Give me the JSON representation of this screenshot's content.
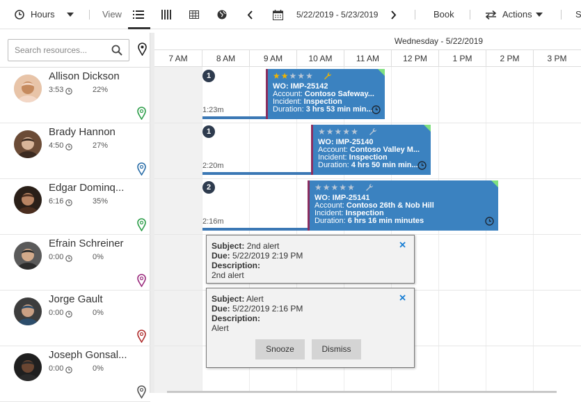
{
  "toolbar": {
    "hours_label": "Hours",
    "view_label": "View",
    "date_range": "5/22/2019 - 5/23/2019",
    "book_label": "Book",
    "actions_label": "Actions",
    "selected_view": "list-view-icon"
  },
  "search": {
    "placeholder": "Search resources..."
  },
  "schedule": {
    "day_header": "Wednesday - 5/22/2019",
    "hours": [
      "7 AM",
      "8 AM",
      "9 AM",
      "10 AM",
      "11 AM",
      "12 PM",
      "1 PM",
      "2 PM",
      "3 PM"
    ]
  },
  "resources": [
    {
      "name": "Allison Dickson",
      "hours": "3:53",
      "pct": "22%",
      "pin_color": "#2e9e4a"
    },
    {
      "name": "Brady Hannon",
      "hours": "4:50",
      "pct": "27%",
      "pin_color": "#2a6ea8"
    },
    {
      "name": "Edgar Dominq...",
      "hours": "6:16",
      "pct": "35%",
      "pin_color": "#2e9e4a"
    },
    {
      "name": "Efrain Schreiner",
      "hours": "0:00",
      "pct": "0%",
      "pin_color": "#9b2c7e"
    },
    {
      "name": "Jorge Gault",
      "hours": "0:00",
      "pct": "0%",
      "pin_color": "#b02e2e"
    },
    {
      "name": "Joseph Gonsal...",
      "hours": "0:00",
      "pct": "0%",
      "pin_color": "#555555"
    }
  ],
  "bookings": [
    {
      "count": "1",
      "travel": "1:23m",
      "stars": 2,
      "wo_label": "WO:",
      "wo": "IMP-25142",
      "account_label": "Account:",
      "account": "Contoso Safeway...",
      "incident_label": "Incident:",
      "incident": "Inspection",
      "duration_label": "Duration:",
      "duration": "3 hrs 53 min min..."
    },
    {
      "count": "1",
      "travel": "2:20m",
      "stars": 0,
      "wo_label": "WO:",
      "wo": "IMP-25140",
      "account_label": "Account:",
      "account": "Contoso Valley M...",
      "incident_label": "Incident:",
      "incident": "Inspection",
      "duration_label": "Duration:",
      "duration": "4 hrs 50 min min..."
    },
    {
      "count": "2",
      "travel": "2:16m",
      "stars": 0,
      "wo_label": "WO:",
      "wo": "IMP-25141",
      "account_label": "Account:",
      "account": "Contoso 26th & Nob Hill",
      "incident_label": "Incident:",
      "incident": "Inspection",
      "duration_label": "Duration:",
      "duration": "6 hrs 16 min minutes"
    }
  ],
  "alerts": [
    {
      "subject_label": "Subject:",
      "subject": "2nd alert",
      "due_label": "Due:",
      "due": "5/22/2019 2:19 PM",
      "description_label": "Description:",
      "description": "2nd alert"
    },
    {
      "subject_label": "Subject:",
      "subject": "Alert",
      "due_label": "Due:",
      "due": "5/22/2019 2:16 PM",
      "description_label": "Description:",
      "description": "Alert",
      "snooze_label": "Snooze",
      "dismiss_label": "Dismiss"
    }
  ],
  "colors": {
    "booking": "#3b82c0",
    "travel": "#3b78b5",
    "link": "#1a7fd4",
    "star_filled": "#f0b400",
    "star_empty": "#b9c7d6"
  }
}
